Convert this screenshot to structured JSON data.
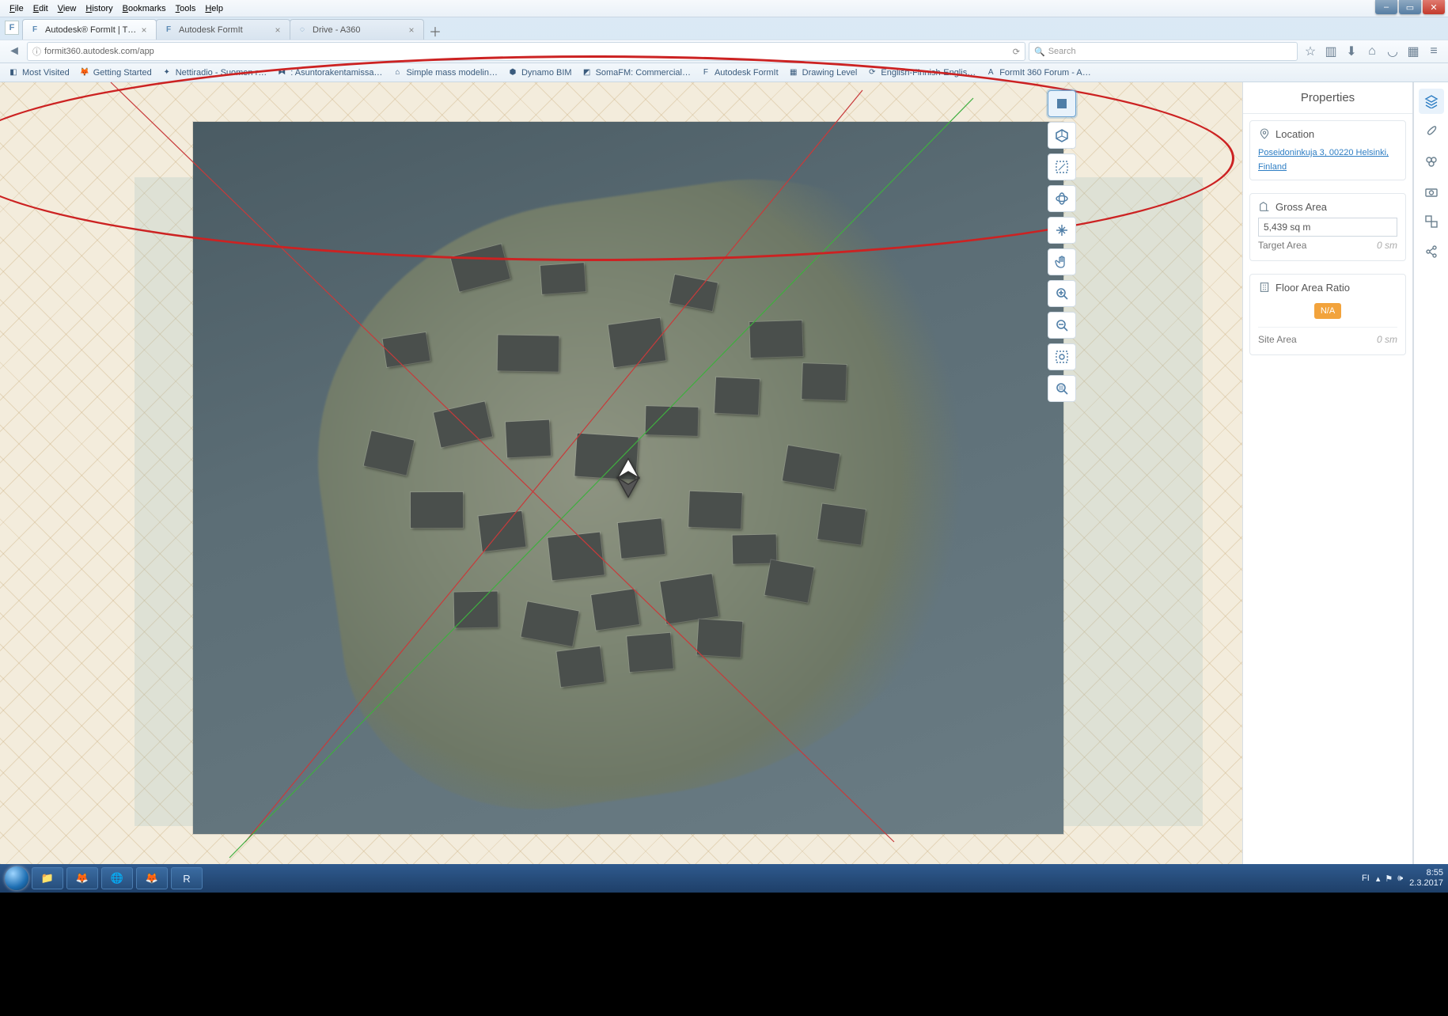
{
  "menubar": {
    "items": [
      "File",
      "Edit",
      "View",
      "History",
      "Bookmarks",
      "Tools",
      "Help"
    ]
  },
  "window_buttons": {
    "min": "–",
    "max": "▭",
    "close": "✕"
  },
  "tabs": [
    {
      "label": "Autodesk® FormIt | Think …",
      "icon": "F",
      "active": true
    },
    {
      "label": "Autodesk FormIt",
      "icon": "F",
      "active": false
    },
    {
      "label": "Drive - A360",
      "icon": "◌",
      "active": false
    }
  ],
  "navbar": {
    "url": "formit360.autodesk.com/app",
    "search_placeholder": "Search"
  },
  "toolbar_icons": [
    "star",
    "books",
    "down",
    "home",
    "pocket",
    "grid",
    "menu"
  ],
  "bookmarks": [
    {
      "icon": "◧",
      "label": "Most Visited"
    },
    {
      "icon": "🦊",
      "label": "Getting Started"
    },
    {
      "icon": "✦",
      "label": "Nettiradio - Suomen r…"
    },
    {
      "icon": "⧓",
      "label": ": Asuntorakentamissa…"
    },
    {
      "icon": "⌂",
      "label": "Simple mass modelin…"
    },
    {
      "icon": "⬢",
      "label": "Dynamo BIM"
    },
    {
      "icon": "◩",
      "label": "SomaFM: Commercial…"
    },
    {
      "icon": "F",
      "label": "Autodesk FormIt"
    },
    {
      "icon": "▦",
      "label": "Drawing Level"
    },
    {
      "icon": "⟳",
      "label": "English-Finnish-Englis…"
    },
    {
      "icon": "A",
      "label": "FormIt 360 Forum - A…"
    }
  ],
  "tools": [
    "selection",
    "cube",
    "section",
    "orbit",
    "pan",
    "hand",
    "zoom-in",
    "zoom-out",
    "zoom-fit",
    "zoom-sel"
  ],
  "panel": {
    "title": "Properties",
    "location": {
      "heading": "Location",
      "address": "Poseidoninkuja 3, 00220 Helsinki, Finland"
    },
    "gross_area": {
      "heading": "Gross Area",
      "value": "5,439 sq m",
      "target_label": "Target Area",
      "target_value": "0 sm"
    },
    "far": {
      "heading": "Floor Area Ratio",
      "badge": "N/A",
      "site_label": "Site Area",
      "site_value": "0 sm"
    }
  },
  "dock": [
    "layers",
    "brush",
    "materials",
    "camera",
    "groups",
    "share"
  ],
  "taskbar": {
    "apps": [
      "📁",
      "🦊",
      "🌐",
      "🦊",
      "R"
    ],
    "lang": "FI",
    "tray": [
      "▴",
      "⚑",
      "🕪"
    ],
    "time": "8:55",
    "date": "2.3.2017"
  }
}
